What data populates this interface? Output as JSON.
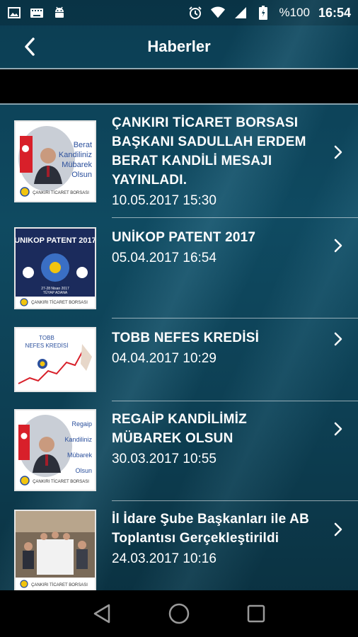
{
  "status_bar": {
    "battery": "%100",
    "time": "16:54",
    "icons": [
      "image-icon",
      "keyboard-icon",
      "android-icon",
      "alarm-icon",
      "wifi-icon",
      "signal-icon",
      "battery-icon"
    ]
  },
  "app_bar": {
    "title": "Haberler",
    "back_icon": "chevron-left-icon"
  },
  "news": [
    {
      "title": "ÇANKIRI TİCARET BORSASI BAŞKANI SADULLAH ERDEM BERAT KANDİLİ MESAJI YAYINLADI.",
      "date": "10.05.2017 15:30",
      "thumb": {
        "caption_lines": [
          "Berat",
          "Kandiliniz",
          "Mübarek",
          "Olsun"
        ],
        "footer": "ÇANKIRI TİCARET BORSASI"
      }
    },
    {
      "title": "UNİKOP PATENT 2017",
      "date": "05.04.2017 16:54",
      "thumb": {
        "heading": "UNIKOP PATENT 2017",
        "subtext": "27-28 Nisan 2017",
        "subtext2": "TÜYAP ADANA",
        "footer": "ÇANKIRI TİCARET BORSASI"
      }
    },
    {
      "title": "TOBB NEFES KREDİSİ",
      "date": "04.04.2017 10:29",
      "thumb": {
        "heading": "TOBB",
        "subheading": "NEFES KREDİSİ"
      }
    },
    {
      "title": "REGAİP KANDİLİMİZ MÜBAREK OLSUN",
      "date": "30.03.2017 10:55",
      "thumb": {
        "caption_lines": [
          "Regaip",
          "Kandiliniz",
          "Mübarek",
          "Olsun"
        ],
        "footer": "ÇANKIRI TİCARET BORSASI"
      }
    },
    {
      "title": "İl İdare Şube Başkanları ile AB Toplantısı Gerçekleştirildi",
      "date": "24.03.2017 10:16",
      "thumb": {
        "footer": "ÇANKIRI TİCARET BORSASI"
      }
    }
  ],
  "nav_bar": {
    "icons": [
      "back-triangle-icon",
      "home-circle-icon",
      "recents-square-icon"
    ]
  },
  "colors": {
    "background": "#0d3a4c",
    "text": "#ffffff",
    "band": "#000000",
    "thumb_blue": "#2a4f9c",
    "flag_red": "#d8202a"
  }
}
